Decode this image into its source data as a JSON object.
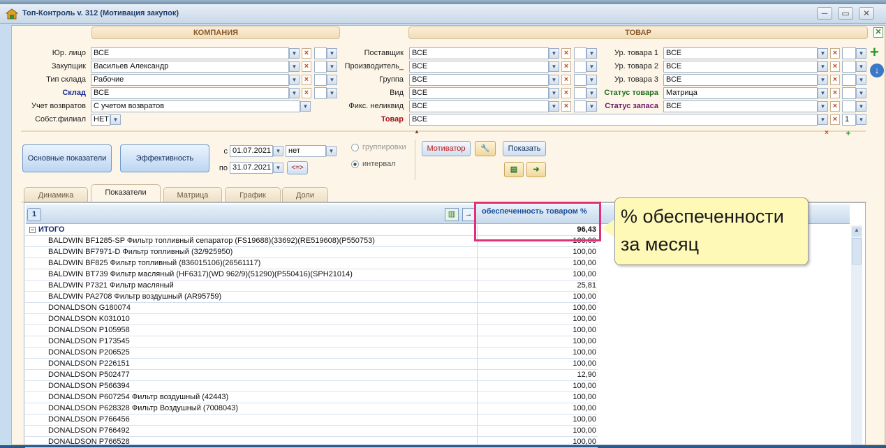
{
  "window": {
    "title": "Топ-Контроль v. 312 (Мотивация закупок)",
    "min": "─",
    "max": "▭",
    "close": "✕"
  },
  "sections": {
    "company": "КОМПАНИЯ",
    "goods": "ТОВАР"
  },
  "company_filters": [
    {
      "label": "Юр. лицо",
      "value": "ВСЕ"
    },
    {
      "label": "Закупщик",
      "value": "Васильев Александр"
    },
    {
      "label": "Тип склада",
      "value": "Рабочие"
    },
    {
      "label": "Склад",
      "value": "ВСЕ"
    },
    {
      "label": "Учет возвратов",
      "value": "С учетом возвратов"
    },
    {
      "label": "Собст.филиал",
      "value": "НЕТ"
    }
  ],
  "goods_filters": [
    {
      "label": "Поставщик",
      "value": "ВСЕ"
    },
    {
      "label": "Производитель_",
      "value": "ВСЕ"
    },
    {
      "label": "Группа",
      "value": "ВСЕ"
    },
    {
      "label": "Вид",
      "value": "ВСЕ"
    },
    {
      "label": "Фикс. неликвид",
      "value": "ВСЕ"
    },
    {
      "label": "Товар",
      "value": "ВСЕ"
    }
  ],
  "goods_filters2": [
    {
      "label": "Ур. товара 1",
      "value": "ВСЕ"
    },
    {
      "label": "Ур. товара 2",
      "value": "ВСЕ"
    },
    {
      "label": "Ур. товара 3",
      "value": "ВСЕ"
    },
    {
      "label": "Статус товара",
      "value": "Матрица"
    },
    {
      "label": "Статус запаса",
      "value": "ВСЕ"
    }
  ],
  "tovar_count": "1",
  "buttons": {
    "main_indicators": "Основные показатели",
    "efficiency": "Эффективность",
    "motivator": "Мотиватор",
    "show": "Показать",
    "swap": "<=>"
  },
  "period": {
    "from_label": "с",
    "from": "01.07.2021",
    "to_label": "по",
    "to": "31.07.2021",
    "flag": "нет"
  },
  "mode": {
    "grouping": "группировки",
    "interval": "интервал"
  },
  "tabs": [
    "Динамика",
    "Показатели",
    "Матрица",
    "График",
    "Доли"
  ],
  "grid": {
    "page": "1",
    "column": "обеспеченность товаром %",
    "total_label": "ИТОГО",
    "total_value": "96,43",
    "rows": [
      {
        "name": "BALDWIN BF1285-SP Фильтр топливный сепаратор (FS19688)(33692)(RE519608)(P550753)",
        "value": "100,00"
      },
      {
        "name": "BALDWIN BF7971-D Фильтр топливный (32/925950)",
        "value": "100,00"
      },
      {
        "name": "BALDWIN BF825 Фильтр топливный (836015106)(26561117)",
        "value": "100,00"
      },
      {
        "name": "BALDWIN BT739 Фильтр масляный (HF6317)(WD 962/9)(51290)(P550416)(SPH21014)",
        "value": "100,00"
      },
      {
        "name": "BALDWIN P7321 Фильтр масляный",
        "value": "25,81"
      },
      {
        "name": "BALDWIN PA2708 Фильтр воздушный (AR95759)",
        "value": "100,00"
      },
      {
        "name": "DONALDSON G180074",
        "value": "100,00"
      },
      {
        "name": "DONALDSON K031010",
        "value": "100,00"
      },
      {
        "name": "DONALDSON P105958",
        "value": "100,00"
      },
      {
        "name": "DONALDSON P173545",
        "value": "100,00"
      },
      {
        "name": "DONALDSON P206525",
        "value": "100,00"
      },
      {
        "name": "DONALDSON P226151",
        "value": "100,00"
      },
      {
        "name": "DONALDSON P502477",
        "value": "12,90"
      },
      {
        "name": "DONALDSON P566394",
        "value": "100,00"
      },
      {
        "name": "DONALDSON P607254 Фильтр воздушный (42443)",
        "value": "100,00"
      },
      {
        "name": "DONALDSON P628328 Фильтр Воздушный  (7008043)",
        "value": "100,00"
      },
      {
        "name": "DONALDSON P766456",
        "value": "100,00"
      },
      {
        "name": "DONALDSON P766492",
        "value": "100,00"
      },
      {
        "name": "DONALDSON P766528",
        "value": "100,00"
      }
    ]
  },
  "callout": {
    "line1": "% обеспеченности",
    "line2": "за месяц"
  },
  "colors": {
    "highlight": "#e0307a",
    "callout_bg": "#fff9b8"
  }
}
